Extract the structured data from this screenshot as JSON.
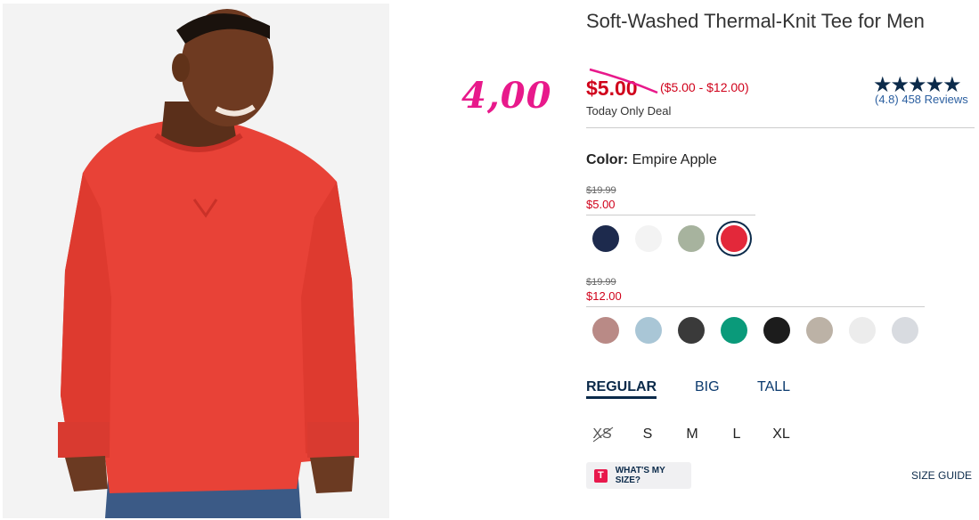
{
  "annotation": {
    "handwritten_price": "4,00"
  },
  "product": {
    "title": "Soft-Washed Thermal-Knit Tee for Men",
    "price": "$5.00",
    "price_range": "($5.00 - $12.00)",
    "deal_label": "Today Only Deal",
    "rating_stars": "★★★★★",
    "rating_text": "(4.8) 458 Reviews"
  },
  "color": {
    "label": "Color:",
    "selected_name": "Empire Apple",
    "groups": [
      {
        "old_price": "$19.99",
        "new_price": "$5.00",
        "swatches": [
          {
            "name": "navy",
            "color": "#1d2a4d"
          },
          {
            "name": "white",
            "color": "#f3f3f3"
          },
          {
            "name": "sage",
            "color": "#a7b39e"
          },
          {
            "name": "empire-apple",
            "color": "#e3283a",
            "selected": true
          }
        ]
      },
      {
        "old_price": "$19.99",
        "new_price": "$12.00",
        "swatches": [
          {
            "name": "mauve",
            "color": "#b98a86"
          },
          {
            "name": "light-blue",
            "color": "#a9c6d6"
          },
          {
            "name": "charcoal",
            "color": "#3a3a3a"
          },
          {
            "name": "green",
            "color": "#0a9a7a"
          },
          {
            "name": "black",
            "color": "#1c1c1c"
          },
          {
            "name": "oatmeal",
            "color": "#bcb2a6"
          },
          {
            "name": "off-white",
            "color": "#ececec"
          },
          {
            "name": "light-grey",
            "color": "#d8dbe0"
          }
        ]
      }
    ]
  },
  "fit_tabs": [
    "REGULAR",
    "BIG",
    "TALL"
  ],
  "sizes": [
    "XS",
    "S",
    "M",
    "L",
    "XL"
  ],
  "fit_helper": {
    "icon": "T",
    "label": "WHAT'S MY SIZE?"
  },
  "size_guide": "SIZE GUIDE",
  "colors": {
    "sale_red": "#d0021b",
    "navy": "#0b2a4a",
    "annotation_pink": "#e8198b"
  }
}
